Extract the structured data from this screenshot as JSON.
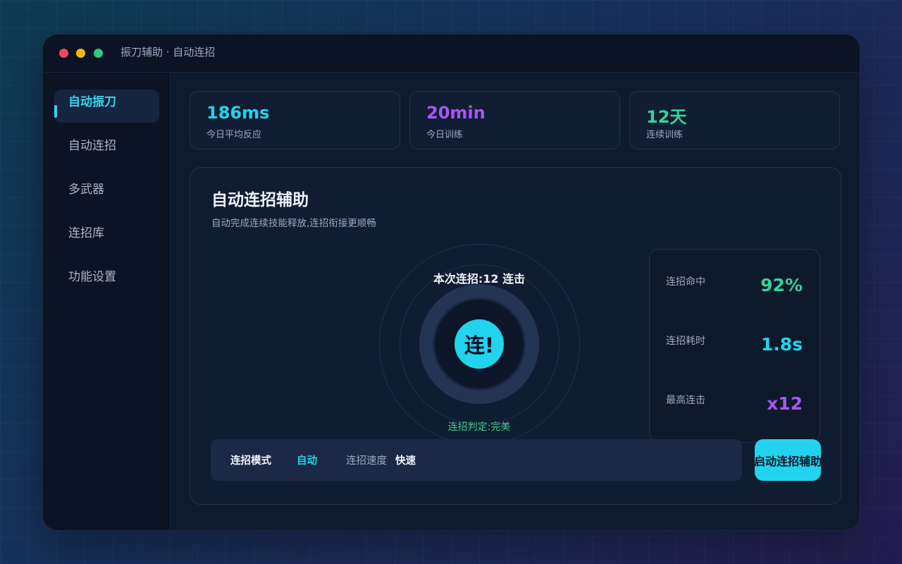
{
  "window": {
    "title": "振刀辅助 · 自动连招"
  },
  "sidebar": {
    "items": [
      {
        "label": "自动振刀",
        "active": true
      },
      {
        "label": "自动连招",
        "active": false
      },
      {
        "label": "多武器",
        "active": false
      },
      {
        "label": "连招库",
        "active": false
      },
      {
        "label": "功能设置",
        "active": false
      }
    ]
  },
  "stats": [
    {
      "value": "186ms",
      "label": "今日平均反应",
      "color": "#22d3ee"
    },
    {
      "value": "20min",
      "label": "今日训练",
      "color": "#a855f7"
    },
    {
      "value": "12天",
      "label": "连续训练",
      "color": "#34d399"
    }
  ],
  "panel": {
    "title": "自动连招辅助",
    "subtitle": "自动完成连续技能释放,连招衔接更顺畅",
    "combo_count": "本次连招:12 连击",
    "core_label": "连!",
    "judge": "连招判定:完美"
  },
  "metrics": [
    {
      "label": "连招命中",
      "value": "92%",
      "color": "#34d399"
    },
    {
      "label": "连招耗时",
      "value": "1.8s",
      "color": "#22d3ee"
    },
    {
      "label": "最高连击",
      "value": "x12",
      "color": "#a855f7"
    }
  ],
  "bottom_bar": {
    "mode_label": "连招模式",
    "mode_value": "自动",
    "speed_label": "连招速度",
    "speed_value": "快速"
  },
  "start_button": {
    "label": "启动连招辅助"
  },
  "colors": {
    "accent": "#22d3ee",
    "purple": "#a855f7",
    "green": "#34d399"
  }
}
